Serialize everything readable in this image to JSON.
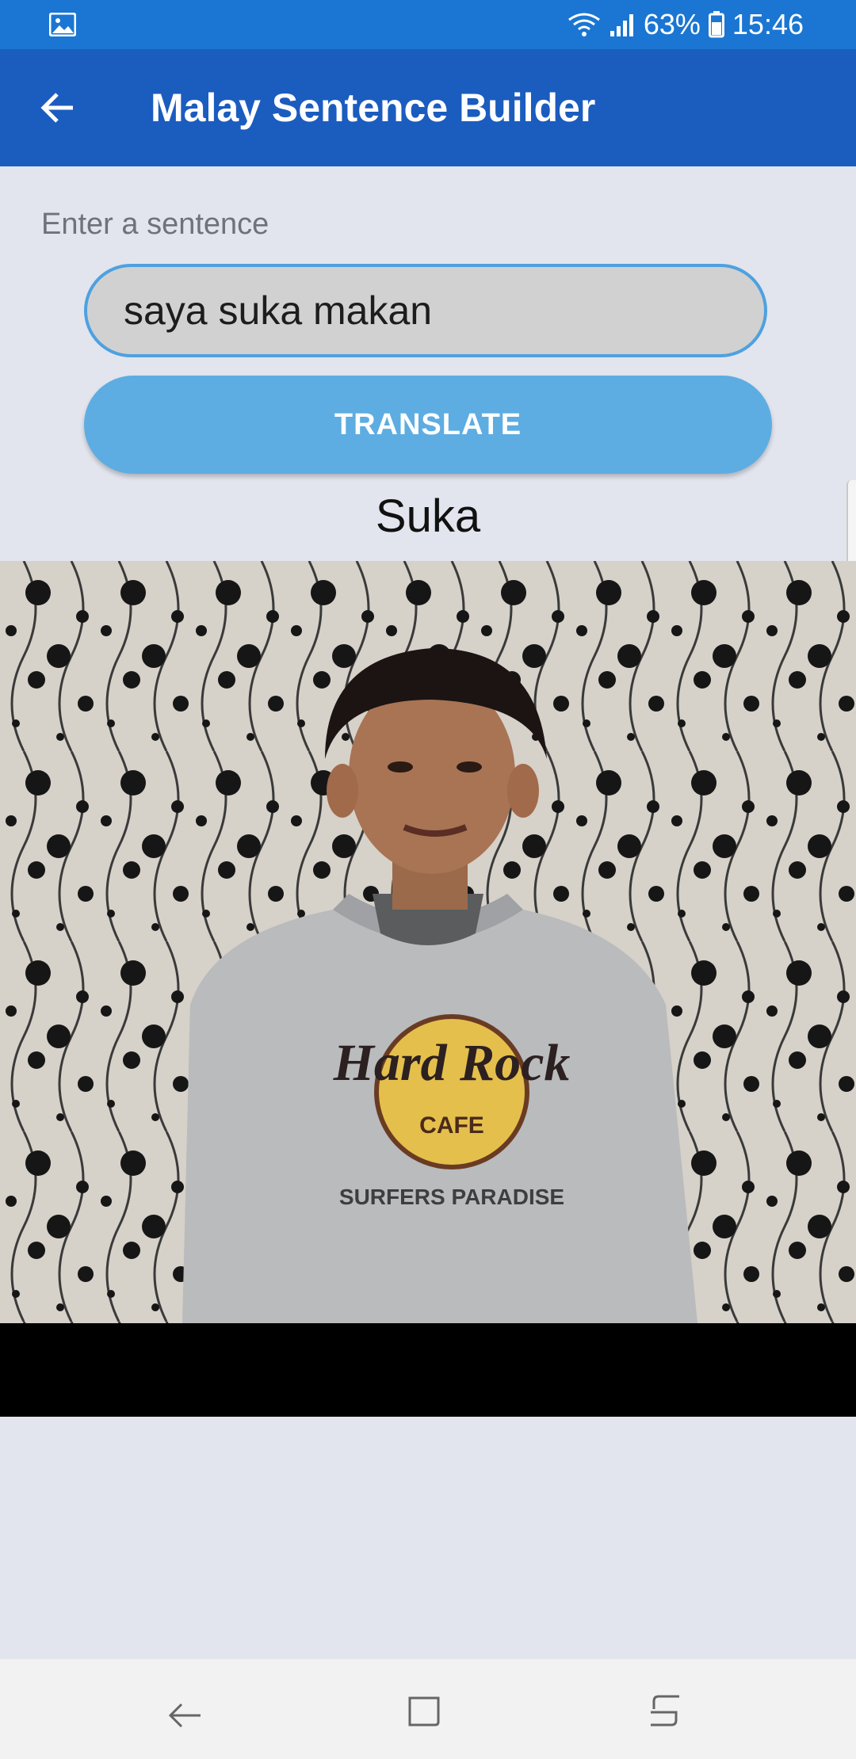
{
  "status_bar": {
    "battery": "63%",
    "time": "15:46",
    "icons": [
      "gallery-notification-icon",
      "wifi-icon",
      "signal-icon",
      "battery-icon"
    ]
  },
  "app_bar": {
    "title": "Malay Sentence Builder",
    "back_icon": "arrow-left-icon"
  },
  "form": {
    "label": "Enter a sentence",
    "input_value": "saya suka makan",
    "button_label": "TRANSLATE"
  },
  "result": {
    "word": "Suka"
  },
  "sign_image": {
    "shirt_text_1": "Hard Rock",
    "shirt_text_2": "CAFE",
    "shirt_text_3": "SURFERS PARADISE"
  },
  "nav_bar": {
    "icons": [
      "nav-back-icon",
      "nav-home-icon",
      "nav-recents-icon"
    ]
  },
  "colors": {
    "status_bar": "#1a76d2",
    "app_bar": "#1b5cbf",
    "button": "#5dade2",
    "input_border": "#4ea1e0",
    "background": "#e2e5ee"
  }
}
